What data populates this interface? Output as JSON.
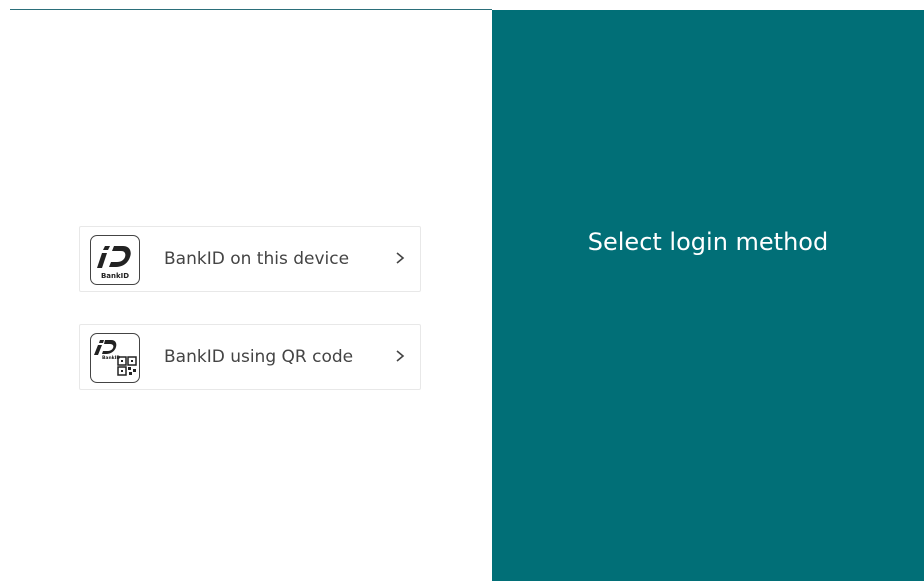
{
  "page": {
    "title": "Select login method"
  },
  "login_options": [
    {
      "label": "BankID on this device",
      "icon": "bankid-logo-icon",
      "action_icon": "chevron-right-icon"
    },
    {
      "label": "BankID using QR code",
      "icon": "bankid-qr-logo-icon",
      "action_icon": "chevron-right-icon"
    }
  ],
  "logo_text": "BankID",
  "colors": {
    "panel_background": "#016f77",
    "panel_text": "#ffffff",
    "option_border": "#e8e8e8",
    "option_text": "#444444"
  }
}
